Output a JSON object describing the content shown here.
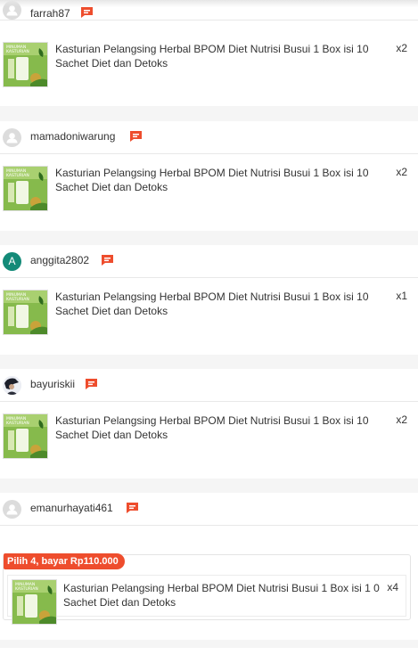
{
  "orders": [
    {
      "username": "farrah87",
      "avatar": "default-user-icon",
      "product": "Kasturian Pelangsing Herbal BPOM Diet Nutrisi Busui 1 Box isi 10 Sachet Diet dan Detoks",
      "qty": "x2"
    },
    {
      "username": "mamadoniwarung",
      "avatar": "default-user-icon",
      "product": "Kasturian Pelangsing Herbal BPOM Diet Nutrisi Busui 1 Box isi 10 Sachet Diet dan Detoks",
      "qty": "x2"
    },
    {
      "username": "anggita2802",
      "avatar_letter": "A",
      "product": "Kasturian Pelangsing Herbal BPOM Diet Nutrisi Busui 1 Box isi 10 Sachet Diet dan Detoks",
      "qty": "x1"
    },
    {
      "username": "bayuriskii",
      "avatar": "photo",
      "product": "Kasturian Pelangsing Herbal BPOM Diet Nutrisi Busui 1 Box isi 10 Sachet Diet dan Detoks",
      "qty": "x2"
    },
    {
      "username": "emanurhayati461",
      "avatar": "default-user-icon",
      "promo": "Pilih 4, bayar Rp110.000",
      "product": "Kasturian Pelangsing Herbal BPOM Diet Nutrisi Busui 1 Box isi 1 0 Sachet Diet dan Detoks",
      "qty": "x4"
    }
  ],
  "product_image_text": [
    "MINUMAN",
    "KASTURIAN"
  ],
  "colors": {
    "accent": "#ee4d2d",
    "avatar_green": "#138a78"
  }
}
